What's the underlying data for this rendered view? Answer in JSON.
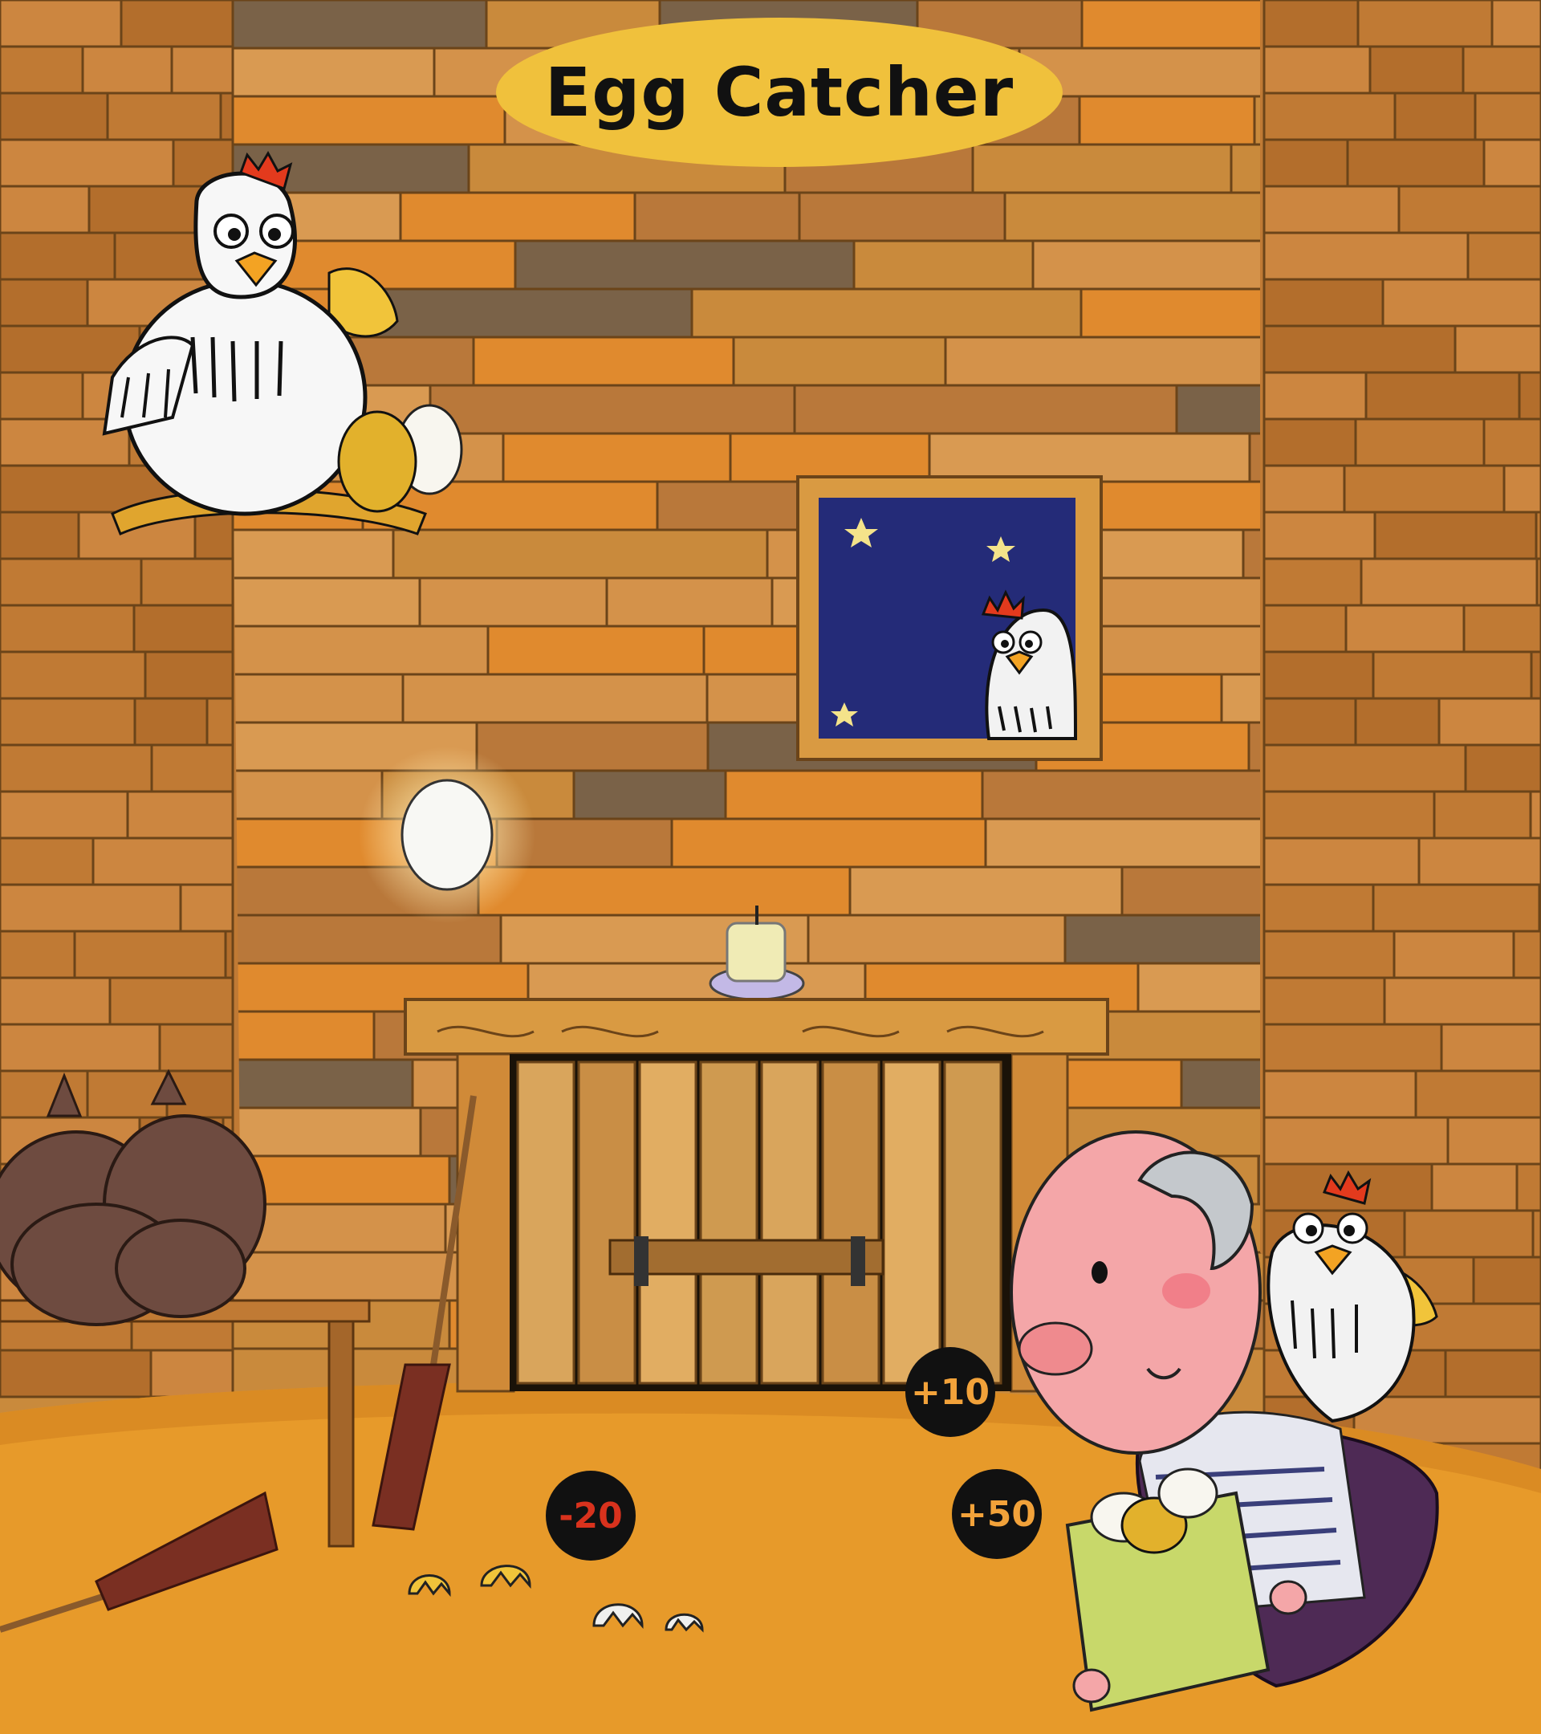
{
  "game": {
    "title": "Egg Catcher"
  },
  "score_badges": [
    {
      "label": "+10",
      "kind": "positive"
    },
    {
      "label": "-20",
      "kind": "negative"
    },
    {
      "label": "+50",
      "kind": "positive"
    }
  ],
  "colors": {
    "title_background": "#f0c13c",
    "badge_background": "#111111",
    "positive_text": "#f2a23a",
    "negative_text": "#d8321d",
    "floor": "#e79a2a",
    "night_sky": "#242b78"
  }
}
